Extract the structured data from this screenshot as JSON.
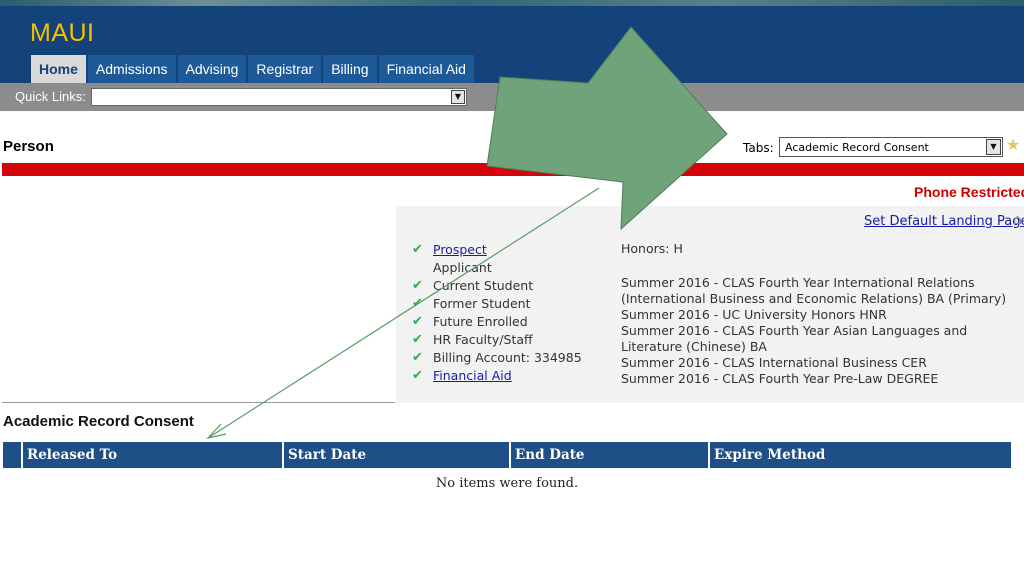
{
  "app": {
    "title": "MAUI"
  },
  "nav": {
    "tabs": [
      {
        "label": "Home",
        "active": true
      },
      {
        "label": "Admissions"
      },
      {
        "label": "Advising"
      },
      {
        "label": "Registrar"
      },
      {
        "label": "Billing"
      },
      {
        "label": "Financial Aid"
      }
    ]
  },
  "quick_links": {
    "label": "Quick Links:",
    "value": ""
  },
  "person": {
    "title": "Person",
    "tabs_label": "Tabs:",
    "tabs_selected": "Academic Record Consent",
    "phone_status": "Phone Restricted",
    "default_landing_link": "Set Default Landing Page"
  },
  "statuses": [
    {
      "label": "Prospect",
      "checked": true,
      "link": true
    },
    {
      "label": "Applicant",
      "checked": false,
      "link": false
    },
    {
      "label": "Current Student",
      "checked": true,
      "link": false
    },
    {
      "label": "Former Student",
      "checked": true,
      "link": false
    },
    {
      "label": "Future Enrolled",
      "checked": true,
      "link": false
    },
    {
      "label": "HR Faculty/Staff",
      "checked": true,
      "link": false
    },
    {
      "label": "Billing Account: 334985",
      "checked": true,
      "link": false
    },
    {
      "label": "Financial Aid",
      "checked": true,
      "link": true
    }
  ],
  "honors": "Honors: H",
  "programs": [
    "Summer 2016 - CLAS Fourth Year International Relations (International Business and Economic Relations) BA (Primary)",
    "Summer 2016 - UC  University Honors HNR",
    "Summer 2016 - CLAS Fourth Year Asian Languages and Literature (Chinese) BA",
    "Summer 2016 - CLAS  International Business CER",
    "Summer 2016 - CLAS Fourth Year Pre-Law DEGREE"
  ],
  "consent": {
    "title": "Academic Record Consent",
    "columns": [
      "",
      "Released To",
      "Start Date",
      "End Date",
      "Expire Method"
    ],
    "empty_message": "No items were found."
  },
  "colors": {
    "header": "#14427a",
    "nav_tab": "#1e5a97",
    "app_title": "#f2c200",
    "red_bar": "#d4050a",
    "table_header": "#1f4f87",
    "annotation_arrow": "#6fa37a",
    "check": "#38a84a"
  }
}
